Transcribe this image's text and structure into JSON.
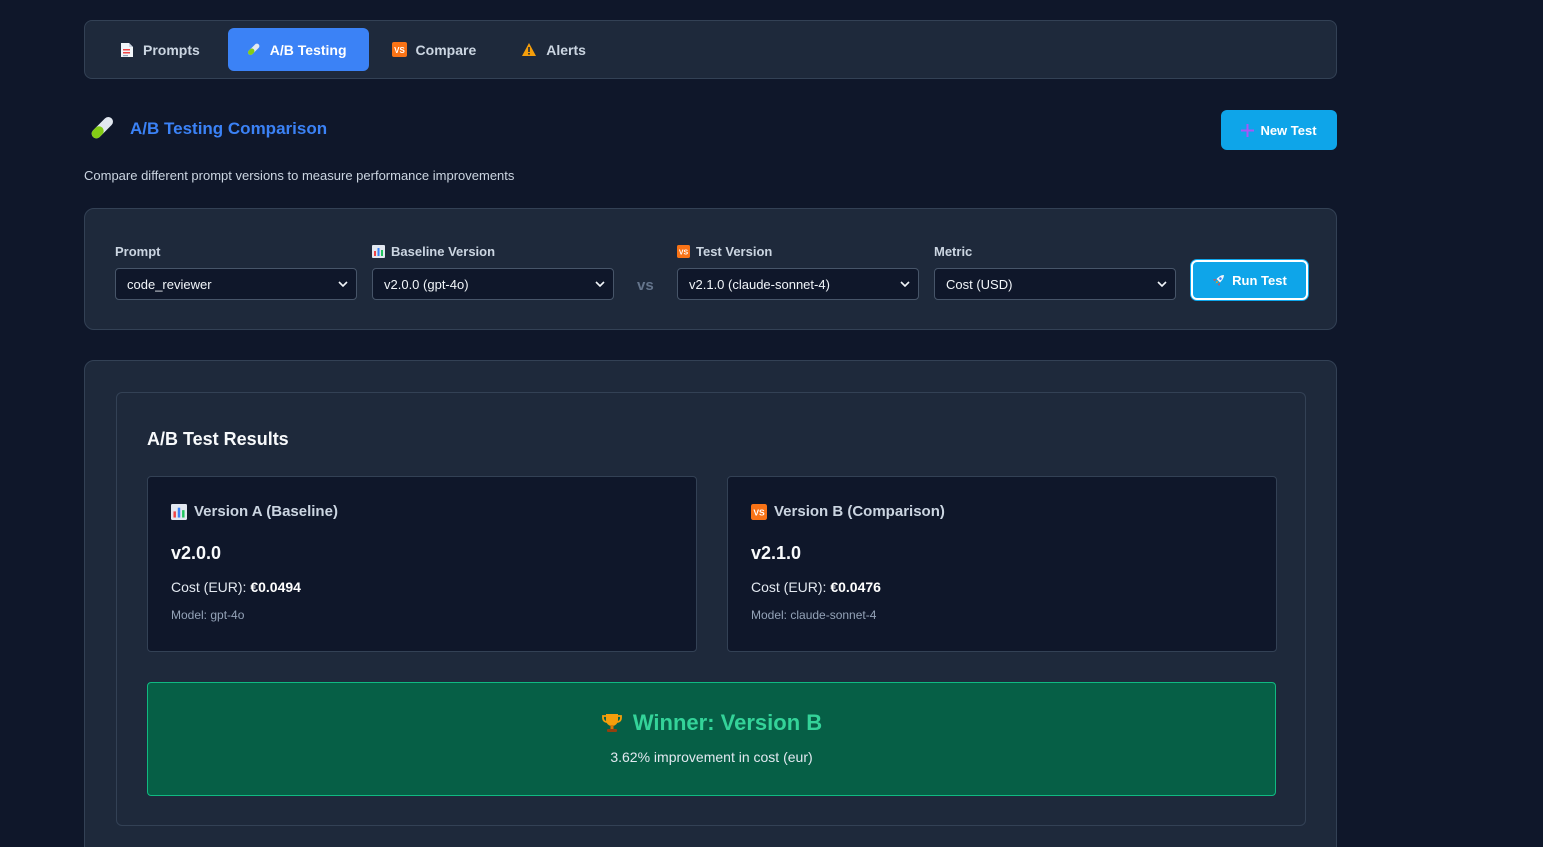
{
  "tabs": [
    {
      "label": "Prompts",
      "icon": "document-icon",
      "active": false
    },
    {
      "label": "A/B Testing",
      "icon": "test-tube-icon",
      "active": true
    },
    {
      "label": "Compare",
      "icon": "vs-icon",
      "active": false
    },
    {
      "label": "Alerts",
      "icon": "warning-icon",
      "active": false
    }
  ],
  "header": {
    "title": "A/B Testing Comparison",
    "subtitle": "Compare different prompt versions to measure performance improvements",
    "new_test_label": "New Test"
  },
  "controls": {
    "prompt": {
      "label": "Prompt",
      "value": "code_reviewer"
    },
    "baseline": {
      "label": "Baseline Version",
      "value": "v2.0.0 (gpt-4o)"
    },
    "vs_label": "vs",
    "test": {
      "label": "Test Version",
      "value": "v2.1.0 (claude-sonnet-4)"
    },
    "metric": {
      "label": "Metric",
      "value": "Cost (USD)"
    },
    "run_label": "Run Test"
  },
  "results": {
    "title": "A/B Test Results",
    "version_a": {
      "heading": "Version A (Baseline)",
      "version": "v2.0.0",
      "cost_label": "Cost (EUR):",
      "cost_value": "€0.0494",
      "model": "Model: gpt-4o"
    },
    "version_b": {
      "heading": "Version B (Comparison)",
      "version": "v2.1.0",
      "cost_label": "Cost (EUR):",
      "cost_value": "€0.0476",
      "model": "Model: claude-sonnet-4"
    },
    "winner": {
      "title": "Winner: Version B",
      "subtitle": "3.62% improvement in cost (eur)"
    }
  },
  "colors": {
    "background": "#0f172a",
    "panel": "#1e293b",
    "accent": "#3b82f6",
    "button": "#0ea5e9",
    "winner_bg": "#065f46",
    "winner_text": "#34d399"
  }
}
